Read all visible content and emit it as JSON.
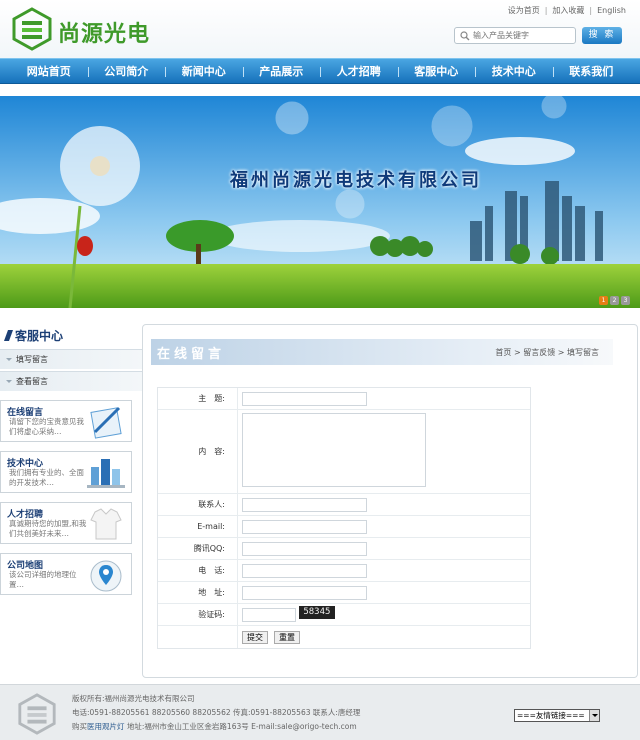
{
  "header": {
    "logo_text": "尚源光电",
    "top_links": [
      "设为首页",
      "加入收藏",
      "English"
    ],
    "search_placeholder": "输入产品关键字",
    "search_button": "搜 索"
  },
  "nav": [
    "网站首页",
    "公司简介",
    "新闻中心",
    "产品展示",
    "人才招聘",
    "客服中心",
    "技术中心",
    "联系我们"
  ],
  "banner": {
    "title": "福州尚源光电技术有限公司",
    "slides": [
      "1",
      "2",
      "3"
    ]
  },
  "sidebar": {
    "title": "客服中心",
    "items": [
      "填写留言",
      "查看留言"
    ],
    "cards": [
      {
        "title": "在线留言",
        "desc": "请留下您的宝贵意见我们将虚心采纳…"
      },
      {
        "title": "技术中心",
        "desc": "我们拥有专业的、全面的开发技术…"
      },
      {
        "title": "人才招聘",
        "desc": "真诚期待您的加盟,和我们共创美好未来…"
      },
      {
        "title": "公司地图",
        "desc": "该公司详细的地理位置…"
      }
    ]
  },
  "main": {
    "title": "在线留言",
    "breadcrumb": [
      "首页",
      "留言反馈",
      "填写留言"
    ],
    "labels": {
      "subject": "主　题:",
      "content": "内　容:",
      "contact": "联系人:",
      "email": "E-mail:",
      "qq": "腾讯QQ:",
      "phone": "电　话:",
      "address": "地　址:",
      "captcha": "验证码:"
    },
    "captcha_code": "58345",
    "submit": "提交",
    "reset": "重置"
  },
  "footer": {
    "copyright": "版权所有:福州尚源光电技术有限公司",
    "phone_line": "电话:0591-88205561 88205560 88205562 传真:0591-88205563 联系人:唐经理",
    "buy_prefix": "购买",
    "buy_link": "医用观片灯",
    "address_line": "地址:福州市金山工业区金岩路163号 E-mail:sale@origo-tech.com",
    "friend_links": "===友情链接==="
  },
  "colors": {
    "nav": "#1671bb",
    "brand_green": "#3f9a2a",
    "title_blue": "#1c3f75"
  }
}
